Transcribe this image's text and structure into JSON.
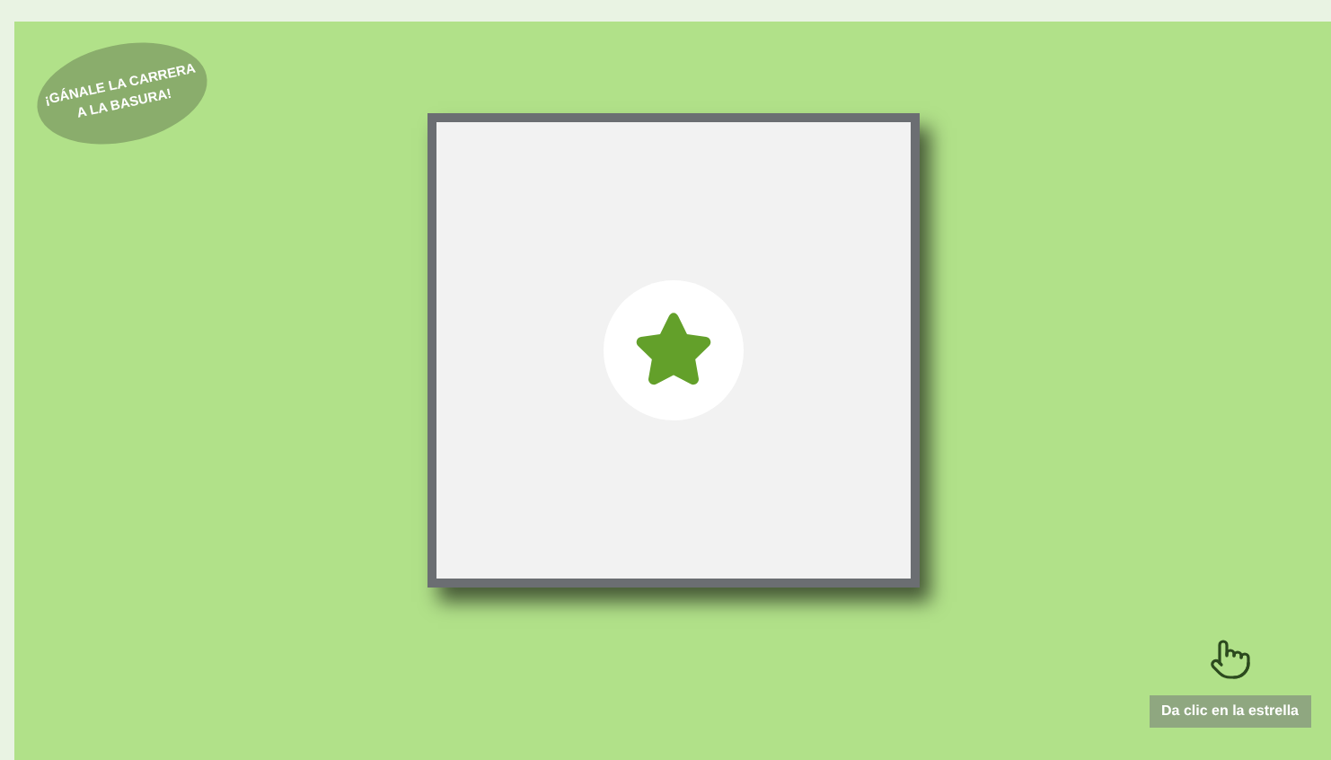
{
  "logo": {
    "lines": [
      "¡GÁNALE LA CARRERA",
      "A LA BASURA!"
    ]
  },
  "star_button": {
    "kind": "star"
  },
  "hint": {
    "label": "Da clic en la estrella"
  }
}
